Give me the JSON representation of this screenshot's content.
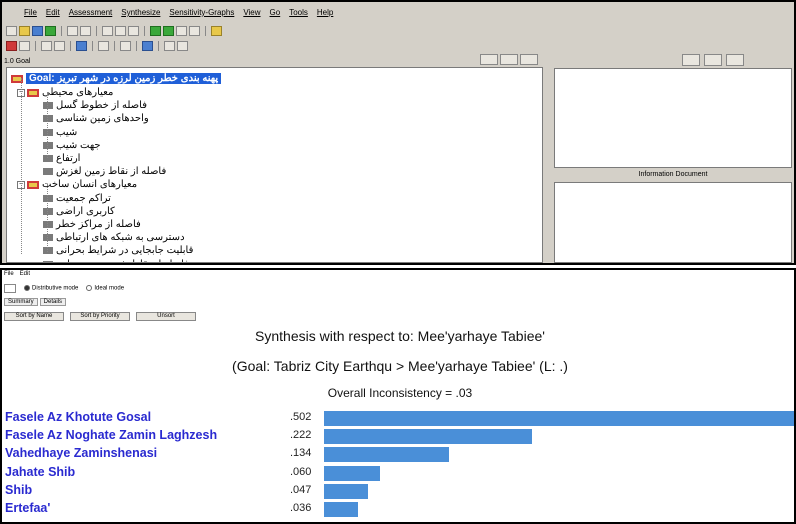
{
  "top_window": {
    "menu": [
      "File",
      "Edit",
      "Assessment",
      "Synthesize",
      "Sensitivity-Graphs",
      "View",
      "Go",
      "Tools",
      "Help"
    ],
    "node_label": "1.0 Goal",
    "goal_tag": "Goal:",
    "goal_text": "پهنه بندی خطر زمین لرزه در شهر تبریز",
    "tree": [
      {
        "label": "معیارهای محیطی",
        "level": 1,
        "group": true
      },
      {
        "label": "فاصله از خطوط گسل",
        "level": 2
      },
      {
        "label": "واحدهای زمین شناسی",
        "level": 2
      },
      {
        "label": "شیب",
        "level": 2
      },
      {
        "label": "جهت شیب",
        "level": 2
      },
      {
        "label": "ارتفاع",
        "level": 2
      },
      {
        "label": "فاصله از نقاط زمین لغزش",
        "level": 2
      },
      {
        "label": "معیارهای انسان ساخت",
        "level": 1,
        "group": true
      },
      {
        "label": "تراکم جمعیت",
        "level": 2
      },
      {
        "label": "کاربری اراضی",
        "level": 2
      },
      {
        "label": "فاصله از مراکز خطر",
        "level": 2
      },
      {
        "label": "دسترسی به شبکه های ارتباطی",
        "level": 2
      },
      {
        "label": "قابلیت جابجایی در شرایط بحرانی",
        "level": 2
      },
      {
        "label": "فاصله از نقاط شهری و روستایی",
        "level": 2
      }
    ],
    "info_document_label": "Information Document"
  },
  "bottom_window": {
    "menu": [
      "File",
      "Edit"
    ],
    "mode_distributive": "Distributive mode",
    "mode_ideal": "Ideal mode",
    "tabs": [
      "Summary",
      "Details"
    ],
    "buttons": [
      "Sort by Name",
      "Sort by Priority",
      "Unsort"
    ],
    "title": "Synthesis with respect to: Mee'yarhaye Tabiee'",
    "subtitle": "(Goal: Tabriz City Earthqu > Mee'yarhaye Tabiee' (L: .)",
    "inconsistency": "Overall Inconsistency = .03",
    "bar_color": "#4a8fd8",
    "label_color": "#2a2ad0"
  },
  "chart_data": {
    "type": "bar",
    "orientation": "horizontal",
    "categories": [
      "Fasele Az Khotute Gosal",
      "Fasele Az Noghate Zamin Laghzesh",
      "Vahedhaye Zaminshenasi",
      "Jahate Shib",
      "Shib",
      "Ertefaa'"
    ],
    "values": [
      0.502,
      0.222,
      0.134,
      0.06,
      0.047,
      0.036
    ],
    "value_labels": [
      ".502",
      ".222",
      ".134",
      ".060",
      ".047",
      ".036"
    ],
    "title": "Synthesis with respect to: Mee'yarhaye Tabiee'",
    "xlim": [
      0,
      0.502
    ]
  }
}
